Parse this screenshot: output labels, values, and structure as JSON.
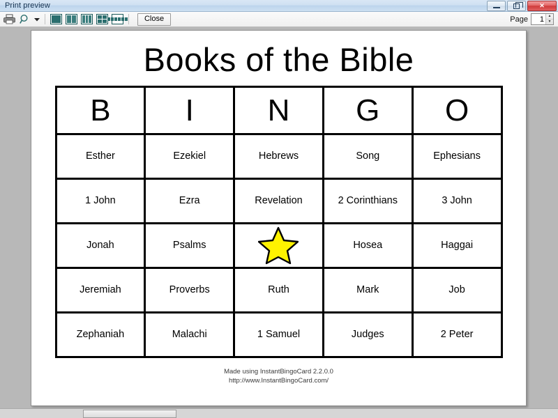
{
  "window": {
    "title": "Print preview",
    "buttons": {
      "minimize": "minimize-icon",
      "restore": "restore-icon",
      "close": "✕"
    }
  },
  "toolbar": {
    "print_icon": "printer-icon",
    "zoom_icon": "magnifier-icon",
    "zoom_dropdown_icon": "chevron-down-icon",
    "page_layout_buttons": [
      {
        "name": "one-page-view",
        "label": "1 page"
      },
      {
        "name": "two-page-view",
        "label": "2 pages"
      },
      {
        "name": "three-page-view",
        "label": "3 pages"
      },
      {
        "name": "four-page-view",
        "label": "4 pages"
      },
      {
        "name": "six-page-view",
        "label": "6 pages"
      }
    ],
    "close_label": "Close",
    "page_label": "Page",
    "page_value": "1",
    "spin_up": "▲",
    "spin_down": "▼"
  },
  "card": {
    "title": "Books of the Bible",
    "headers": [
      "B",
      "I",
      "N",
      "G",
      "O"
    ],
    "rows": [
      [
        "Esther",
        "Ezekiel",
        "Hebrews",
        "Song",
        "Ephesians"
      ],
      [
        "1 John",
        "Ezra",
        "Revelation",
        "2 Corinthians",
        "3 John"
      ],
      [
        "Jonah",
        "Psalms",
        "FREE_STAR",
        "Hosea",
        "Haggai"
      ],
      [
        "Jeremiah",
        "Proverbs",
        "Ruth",
        "Mark",
        "Job"
      ],
      [
        "Zephaniah",
        "Malachi",
        "1 Samuel",
        "Judges",
        "2 Peter"
      ]
    ],
    "free_space_icon": "star-icon",
    "free_space_color": "#FFF200",
    "footer_line1": "Made using InstantBingoCard 2.2.0.0",
    "footer_line2": "http://www.InstantBingoCard.com/"
  },
  "colors": {
    "titlebar_accent": "#cfe0f2",
    "close_button": "#cf3b3b",
    "page_background": "#b8b8b8",
    "paper": "#ffffff",
    "grid_line": "#000000"
  }
}
